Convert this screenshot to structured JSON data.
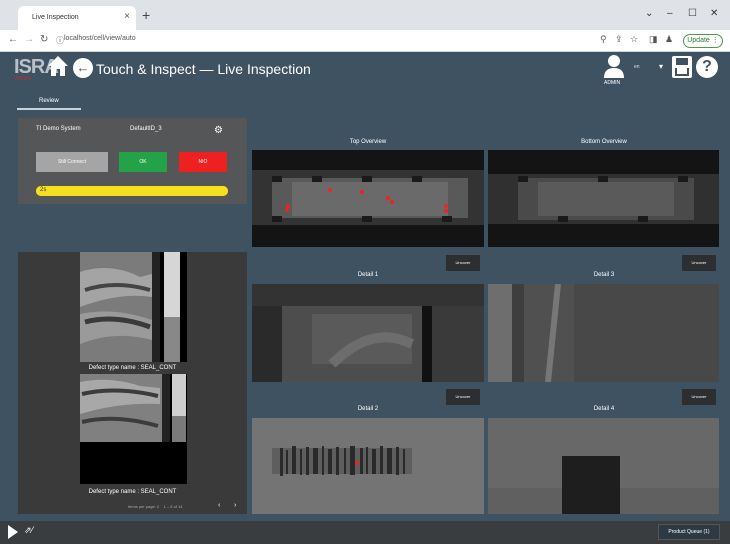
{
  "browser": {
    "tab_title": "Live Inspection",
    "tab_close": "×",
    "new_tab": "+",
    "url": "localhost/cell/view/auto",
    "update_label": "Update",
    "win_min": "⌄",
    "win_restore": "–",
    "win_max": "☐",
    "win_close": "✕"
  },
  "app": {
    "logo": "ISRA",
    "logo_sub": "VISION",
    "title": "Touch & Inspect — Live Inspection",
    "user": "ADMIN",
    "lang": "en",
    "help_icon": "?",
    "review_tab": "Review"
  },
  "control": {
    "system_name": "TI Demo System",
    "default_id": "DefaultID_3",
    "still_button": "Still Connect",
    "ok_button": "OK",
    "nio_button": "NIO",
    "progress_text": "2s",
    "progress_fraction": 1.0
  },
  "gallery": {
    "defect1_label": "Defect type name : SEAL_CONT",
    "defect2_label": "Defect type name : SEAL_CONT",
    "items_per_page": "Items per page: 2",
    "range": "1 – 6 of 14",
    "prev": "‹",
    "next": "›"
  },
  "cameras": {
    "top_overview": "Top Overview",
    "bottom_overview": "Bottom Overview",
    "detail1": "Detail 1",
    "detail2": "Detail 2",
    "detail3": "Detail 3",
    "detail4": "Detail 4",
    "uncover_label": "Uncover"
  },
  "bottombar": {
    "product_queue": "Product Queue (1)"
  },
  "colors": {
    "app_bg": "#3f5262",
    "ok": "#24a247",
    "nio": "#ee2020",
    "progress": "#f5ec1b",
    "still": "#a5a5a5"
  },
  "icons": [
    "home-icon",
    "back-arrow-icon",
    "user-icon",
    "save-icon",
    "help-icon",
    "gear-icon",
    "play-icon",
    "wand-icon"
  ]
}
